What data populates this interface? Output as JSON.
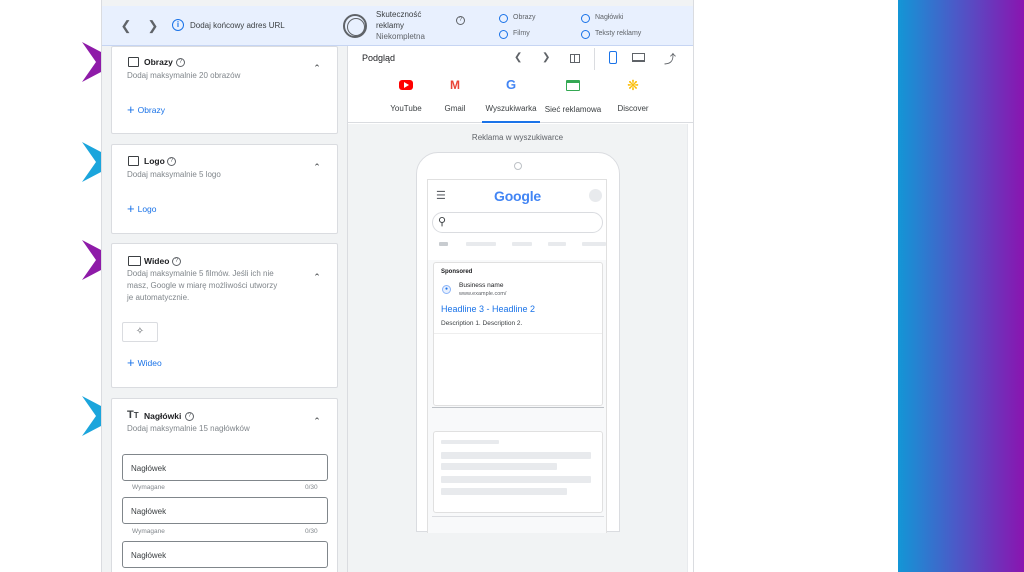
{
  "topbar": {
    "back_icon": "chevron-left-icon",
    "forward_icon": "chevron-right-icon",
    "url_hint": "Dodaj końcowy adres URL",
    "effectiveness_label_1": "Skuteczność",
    "effectiveness_label_2": "reklamy",
    "effectiveness_value": "Niekompletna",
    "options": [
      "Obrazy",
      "Filmy",
      "Nagłówki",
      "Teksty reklamy"
    ]
  },
  "cards": {
    "images": {
      "title": "Obrazy",
      "sub": "Dodaj maksymalnie 20 obrazów",
      "add": "Obrazy"
    },
    "logo": {
      "title": "Logo",
      "sub": "Dodaj maksymalnie 5 logo",
      "add": "Logo"
    },
    "video": {
      "title": "Wideo",
      "sub_1": "Dodaj maksymalnie 5 filmów. Jeśli ich nie",
      "sub_2": "masz, Google w miarę możliwości utworzy",
      "sub_3": "je automatycznie.",
      "add": "Wideo"
    },
    "headlines": {
      "title": "Nagłówki",
      "sub": "Dodaj maksymalnie 15 nagłówków",
      "fields": [
        {
          "placeholder": "Nagłówek",
          "required": "Wymagane",
          "count": "0/30"
        },
        {
          "placeholder": "Nagłówek",
          "required": "Wymagane",
          "count": "0/30"
        },
        {
          "placeholder": "Nagłówek"
        }
      ]
    }
  },
  "preview": {
    "title": "Podgląd",
    "tabs": [
      "YouTube",
      "Gmail",
      "Wyszukiwarka",
      "Sieć reklamowa",
      "Discover"
    ],
    "active_tab": "Wyszukiwarka",
    "caption": "Reklama w wyszukiwarce",
    "phone": {
      "logo": "Google",
      "ad_badge": "Sponsored",
      "business": "Business name",
      "url": "www.example.com/",
      "headline": "Headline 3 - Headline 2",
      "description": "Description 1. Description 2."
    }
  },
  "colors": {
    "accent": "#1a73e8",
    "arrow_purple": "#8e1ba8",
    "arrow_blue": "#1ba5dc"
  }
}
